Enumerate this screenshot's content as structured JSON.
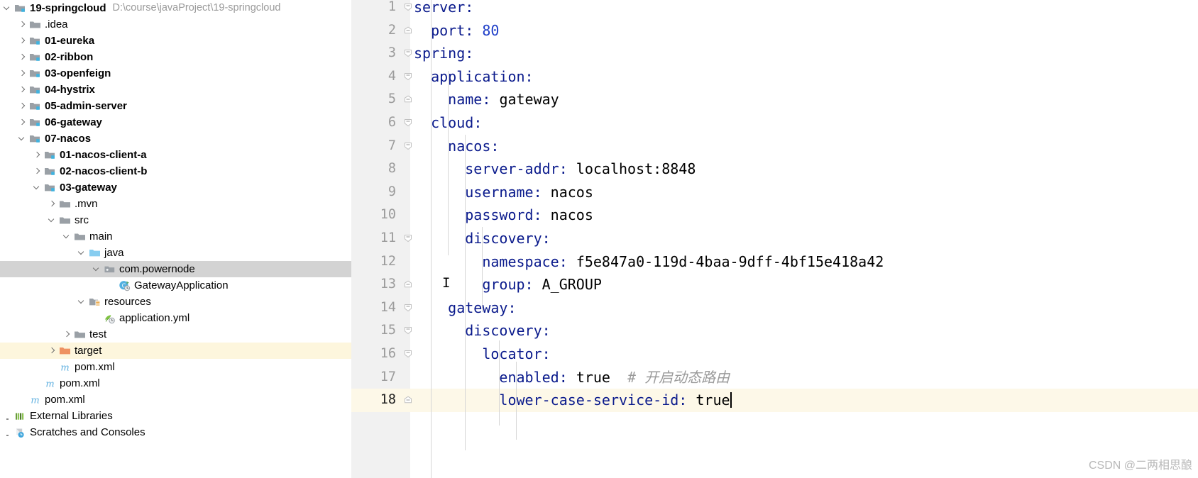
{
  "project_tree": {
    "root_path_hint": "D:\\course\\javaProject\\19-springcloud",
    "items": [
      {
        "label": "19-springcloud",
        "indent": 0,
        "arrow": "down",
        "icon": "module-folder-icon",
        "bold": true,
        "state": "normal",
        "path_hint": true
      },
      {
        "label": ".idea",
        "indent": 1,
        "arrow": "right",
        "icon": "folder-icon",
        "bold": false,
        "state": "normal"
      },
      {
        "label": "01-eureka",
        "indent": 1,
        "arrow": "right",
        "icon": "module-folder-icon",
        "bold": true,
        "state": "normal"
      },
      {
        "label": "02-ribbon",
        "indent": 1,
        "arrow": "right",
        "icon": "module-folder-icon",
        "bold": true,
        "state": "normal"
      },
      {
        "label": "03-openfeign",
        "indent": 1,
        "arrow": "right",
        "icon": "module-folder-icon",
        "bold": true,
        "state": "normal"
      },
      {
        "label": "04-hystrix",
        "indent": 1,
        "arrow": "right",
        "icon": "module-folder-icon",
        "bold": true,
        "state": "normal"
      },
      {
        "label": "05-admin-server",
        "indent": 1,
        "arrow": "right",
        "icon": "module-folder-icon",
        "bold": true,
        "state": "normal"
      },
      {
        "label": "06-gateway",
        "indent": 1,
        "arrow": "right",
        "icon": "module-folder-icon",
        "bold": true,
        "state": "normal"
      },
      {
        "label": "07-nacos",
        "indent": 1,
        "arrow": "down",
        "icon": "module-folder-icon",
        "bold": true,
        "state": "normal"
      },
      {
        "label": "01-nacos-client-a",
        "indent": 2,
        "arrow": "right",
        "icon": "module-folder-icon",
        "bold": true,
        "state": "normal"
      },
      {
        "label": "02-nacos-client-b",
        "indent": 2,
        "arrow": "right",
        "icon": "module-folder-icon",
        "bold": true,
        "state": "normal"
      },
      {
        "label": "03-gateway",
        "indent": 2,
        "arrow": "down",
        "icon": "module-folder-icon",
        "bold": true,
        "state": "normal"
      },
      {
        "label": ".mvn",
        "indent": 3,
        "arrow": "right",
        "icon": "folder-icon",
        "bold": false,
        "state": "normal"
      },
      {
        "label": "src",
        "indent": 3,
        "arrow": "down",
        "icon": "folder-icon",
        "bold": false,
        "state": "normal"
      },
      {
        "label": "main",
        "indent": 4,
        "arrow": "down",
        "icon": "folder-icon",
        "bold": false,
        "state": "normal"
      },
      {
        "label": "java",
        "indent": 5,
        "arrow": "down",
        "icon": "source-folder-icon",
        "bold": false,
        "state": "normal"
      },
      {
        "label": "com.powernode",
        "indent": 6,
        "arrow": "down",
        "icon": "package-icon",
        "bold": false,
        "state": "selected"
      },
      {
        "label": "GatewayApplication",
        "indent": 7,
        "arrow": "none",
        "icon": "java-class-run-icon",
        "bold": false,
        "state": "normal"
      },
      {
        "label": "resources",
        "indent": 5,
        "arrow": "down",
        "icon": "resources-folder-icon",
        "bold": false,
        "state": "normal"
      },
      {
        "label": "application.yml",
        "indent": 6,
        "arrow": "none",
        "icon": "yml-file-icon",
        "bold": false,
        "state": "normal"
      },
      {
        "label": "test",
        "indent": 4,
        "arrow": "right",
        "icon": "folder-icon",
        "bold": false,
        "state": "normal"
      },
      {
        "label": "target",
        "indent": 3,
        "arrow": "right",
        "icon": "target-folder-icon",
        "bold": false,
        "state": "highlighted"
      },
      {
        "label": "pom.xml",
        "indent": 3,
        "arrow": "none",
        "icon": "maven-file-icon",
        "bold": false,
        "state": "normal"
      },
      {
        "label": "pom.xml",
        "indent": 2,
        "arrow": "none",
        "icon": "maven-file-icon",
        "bold": false,
        "state": "normal"
      },
      {
        "label": "pom.xml",
        "indent": 1,
        "arrow": "none",
        "icon": "maven-file-icon",
        "bold": false,
        "state": "normal"
      },
      {
        "label": "External Libraries",
        "indent": 0,
        "arrow": "dot",
        "icon": "external-libraries-icon",
        "bold": false,
        "state": "normal"
      },
      {
        "label": "Scratches and Consoles",
        "indent": 0,
        "arrow": "dot",
        "icon": "scratches-icon",
        "bold": false,
        "state": "normal"
      }
    ]
  },
  "editor": {
    "language": "yaml",
    "caret_line": 18,
    "lines": [
      {
        "no": "1",
        "fold": "start",
        "indent": 0,
        "key": "server",
        "value": "",
        "comment": "",
        "current": false
      },
      {
        "no": "2",
        "fold": "end",
        "indent": 2,
        "key": "port",
        "value": "80",
        "value_type": "number",
        "comment": "",
        "current": false
      },
      {
        "no": "3",
        "fold": "start",
        "indent": 0,
        "key": "spring",
        "value": "",
        "comment": "",
        "current": false
      },
      {
        "no": "4",
        "fold": "start",
        "indent": 2,
        "key": "application",
        "value": "",
        "comment": "",
        "current": false
      },
      {
        "no": "5",
        "fold": "end",
        "indent": 4,
        "key": "name",
        "value": "gateway",
        "comment": "",
        "current": false
      },
      {
        "no": "6",
        "fold": "start",
        "indent": 2,
        "key": "cloud",
        "value": "",
        "comment": "",
        "current": false
      },
      {
        "no": "7",
        "fold": "start",
        "indent": 4,
        "key": "nacos",
        "value": "",
        "comment": "",
        "current": false
      },
      {
        "no": "8",
        "fold": "none",
        "indent": 6,
        "key": "server-addr",
        "value": "localhost:8848",
        "comment": "",
        "current": false
      },
      {
        "no": "9",
        "fold": "none",
        "indent": 6,
        "key": "username",
        "value": "nacos",
        "comment": "",
        "current": false
      },
      {
        "no": "10",
        "fold": "none",
        "indent": 6,
        "key": "password",
        "value": "nacos",
        "comment": "",
        "current": false
      },
      {
        "no": "11",
        "fold": "start",
        "indent": 6,
        "key": "discovery",
        "value": "",
        "comment": "",
        "current": false
      },
      {
        "no": "12",
        "fold": "none",
        "indent": 8,
        "key": "namespace",
        "value": "f5e847a0-119d-4baa-9dff-4bf15e418a42",
        "comment": "",
        "current": false
      },
      {
        "no": "13",
        "fold": "end",
        "indent": 8,
        "key": "group",
        "value": "A_GROUP",
        "comment": "",
        "current": false
      },
      {
        "no": "14",
        "fold": "start",
        "indent": 4,
        "key": "gateway",
        "value": "",
        "comment": "",
        "current": false
      },
      {
        "no": "15",
        "fold": "start",
        "indent": 6,
        "key": "discovery",
        "value": "",
        "comment": "",
        "current": false
      },
      {
        "no": "16",
        "fold": "start",
        "indent": 8,
        "key": "locator",
        "value": "",
        "comment": "",
        "current": false
      },
      {
        "no": "17",
        "fold": "none",
        "indent": 10,
        "key": "enabled",
        "value": "true",
        "comment": "# 开启动态路由",
        "current": false
      },
      {
        "no": "18",
        "fold": "end",
        "indent": 10,
        "key": "lower-case-service-id",
        "value": "true",
        "comment": "",
        "current": true
      }
    ]
  },
  "watermark": {
    "text": "CSDN @二两相思酿"
  },
  "colors": {
    "yaml_key": "#0a1a8c",
    "yaml_number": "#1e3ec8",
    "comment": "#9a9a9a",
    "selection_row": "#d3d3d3",
    "highlight_row": "#fdf6dd",
    "current_line": "#fdf8e8",
    "gutter": "#f1f1f1",
    "lineno": "#9b9b9b"
  }
}
